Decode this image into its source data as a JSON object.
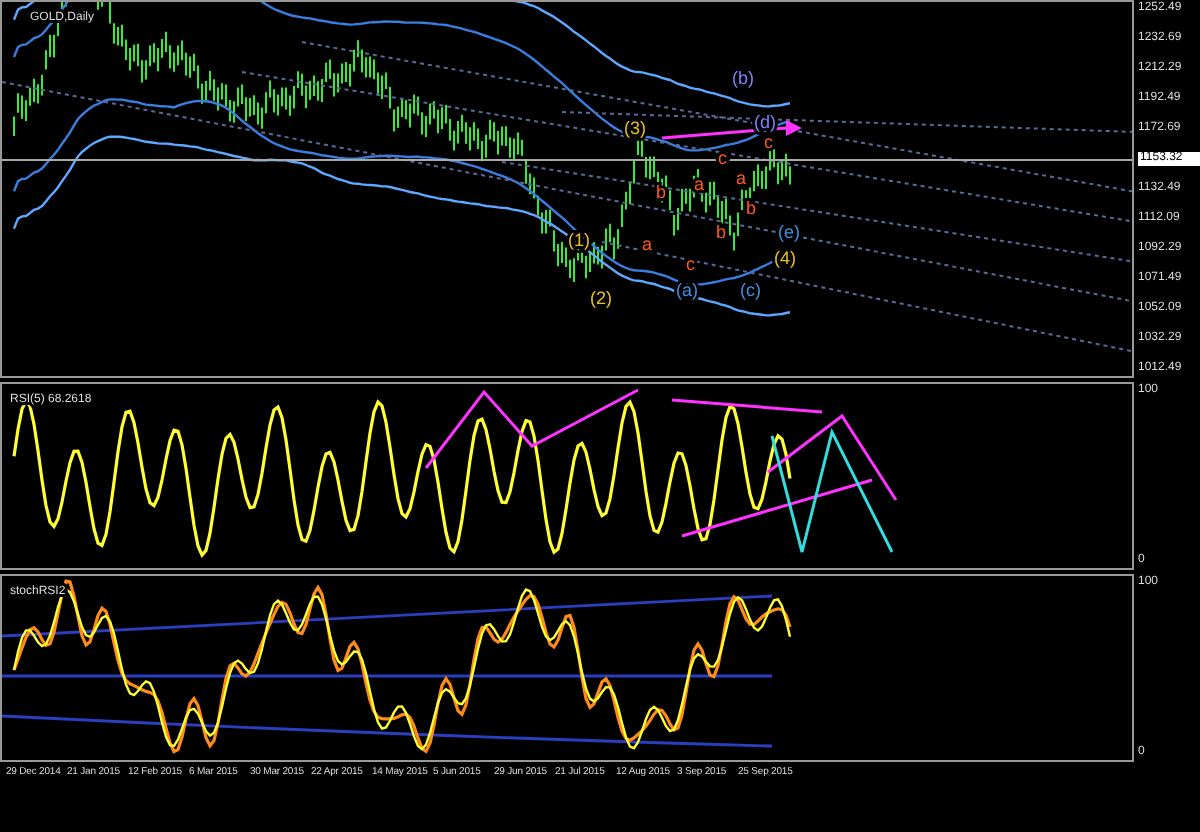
{
  "main_chart": {
    "title": "GOLD,Daily",
    "price_axis": [
      {
        "label": "1252.49",
        "current": false
      },
      {
        "label": "1232.69",
        "current": false
      },
      {
        "label": "1212.29",
        "current": false
      },
      {
        "label": "1192.49",
        "current": false
      },
      {
        "label": "1172.69",
        "current": false
      },
      {
        "label": "1153.32",
        "current": true
      },
      {
        "label": "1132.49",
        "current": false
      },
      {
        "label": "1112.09",
        "current": false
      },
      {
        "label": "1092.29",
        "current": false
      },
      {
        "label": "1071.49",
        "current": false
      },
      {
        "label": "1052.09",
        "current": false
      },
      {
        "label": "1032.29",
        "current": false
      },
      {
        "label": "1012.49",
        "current": false
      }
    ],
    "wave_labels": [
      {
        "text": "(3)",
        "color": "#e8c020"
      },
      {
        "text": "(1)",
        "color": "#e8c020"
      },
      {
        "text": "(2)",
        "color": "#e8c020"
      },
      {
        "text": "a",
        "color": "#ff5a1e"
      },
      {
        "text": "b",
        "color": "#ff5a1e"
      },
      {
        "text": "c",
        "color": "#ff5a1e"
      },
      {
        "text": "a",
        "color": "#ff5a1e"
      },
      {
        "text": "c",
        "color": "#ff5a1e"
      },
      {
        "text": "b",
        "color": "#ff5a1e"
      },
      {
        "text": "a",
        "color": "#ff5a1e"
      },
      {
        "text": "c",
        "color": "#ff5a1e"
      },
      {
        "text": "b",
        "color": "#ff5a1e"
      },
      {
        "text": "(a)",
        "color": "#3d8fe0"
      },
      {
        "text": "(b)",
        "color": "#7f7fff"
      },
      {
        "text": "(c)",
        "color": "#3d8fe0"
      },
      {
        "text": "(d)",
        "color": "#7f7fff"
      },
      {
        "text": "(e)",
        "color": "#3d8fe0"
      },
      {
        "text": "(4)",
        "color": "#e8c020"
      }
    ]
  },
  "rsi_panel": {
    "title": "RSI(5) 68.2618",
    "axis": [
      "100",
      "0"
    ]
  },
  "stoch_panel": {
    "title": "stochRSI2",
    "axis": [
      "100",
      "0"
    ]
  },
  "time_axis": [
    "29 Dec 2014",
    "21 Jan 2015",
    "12 Feb 2015",
    "6 Mar 2015",
    "30 Mar 2015",
    "22 Apr 2015",
    "14 May 2015",
    "5 Jun 2015",
    "29 Jun 2015",
    "21 Jul 2015",
    "12 Aug 2015",
    "3 Sep 2015",
    "25 Sep 2015"
  ]
}
